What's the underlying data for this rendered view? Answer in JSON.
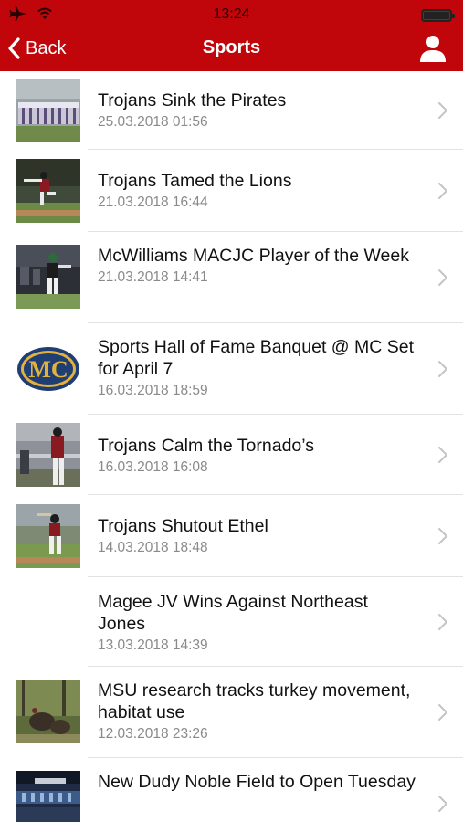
{
  "status_bar": {
    "time": "13:24",
    "icons": [
      "airplane-icon",
      "wifi-icon",
      "battery-icon"
    ]
  },
  "nav": {
    "back_label": "Back",
    "title": "Sports",
    "icons": [
      "chevron-left-icon",
      "user-icon"
    ]
  },
  "colors": {
    "header": "#c1060b",
    "title_text": "#111111",
    "date_text": "#8a8a8a",
    "separator": "#e2e2e2",
    "chevron": "#c4c4c4"
  },
  "articles": [
    {
      "title": "Trojans Sink the Pirates",
      "date": "25.03.2018 01:56",
      "thumbnail": "baseball team lineup photo"
    },
    {
      "title": "Trojans Tamed the Lions",
      "date": "21.03.2018 16:44",
      "thumbnail": "pitcher throwing photo"
    },
    {
      "title": "McWilliams MACJC Player of the Week",
      "date": "21.03.2018 14:41",
      "thumbnail": "batter in dugout photo"
    },
    {
      "title": "Sports Hall of Fame Banquet @ MC Set for April 7",
      "date": "16.03.2018 18:59",
      "thumbnail": "MC logo"
    },
    {
      "title": "Trojans Calm the Tornado’s",
      "date": "16.03.2018 16:08",
      "thumbnail": "players at field fence photo"
    },
    {
      "title": "Trojans Shutout Ethel",
      "date": "14.03.2018 18:48",
      "thumbnail": "batter at plate photo"
    },
    {
      "title": "Magee JV Wins Against Northeast Jones",
      "date": "13.03.2018 14:39",
      "thumbnail": ""
    },
    {
      "title": "MSU research tracks turkey movement, habitat use",
      "date": "12.03.2018 23:26",
      "thumbnail": "wild turkeys photo"
    },
    {
      "title": "New Dudy Noble Field to Open Tuesday",
      "date": "",
      "thumbnail": "Dudy Noble stadium photo"
    }
  ]
}
